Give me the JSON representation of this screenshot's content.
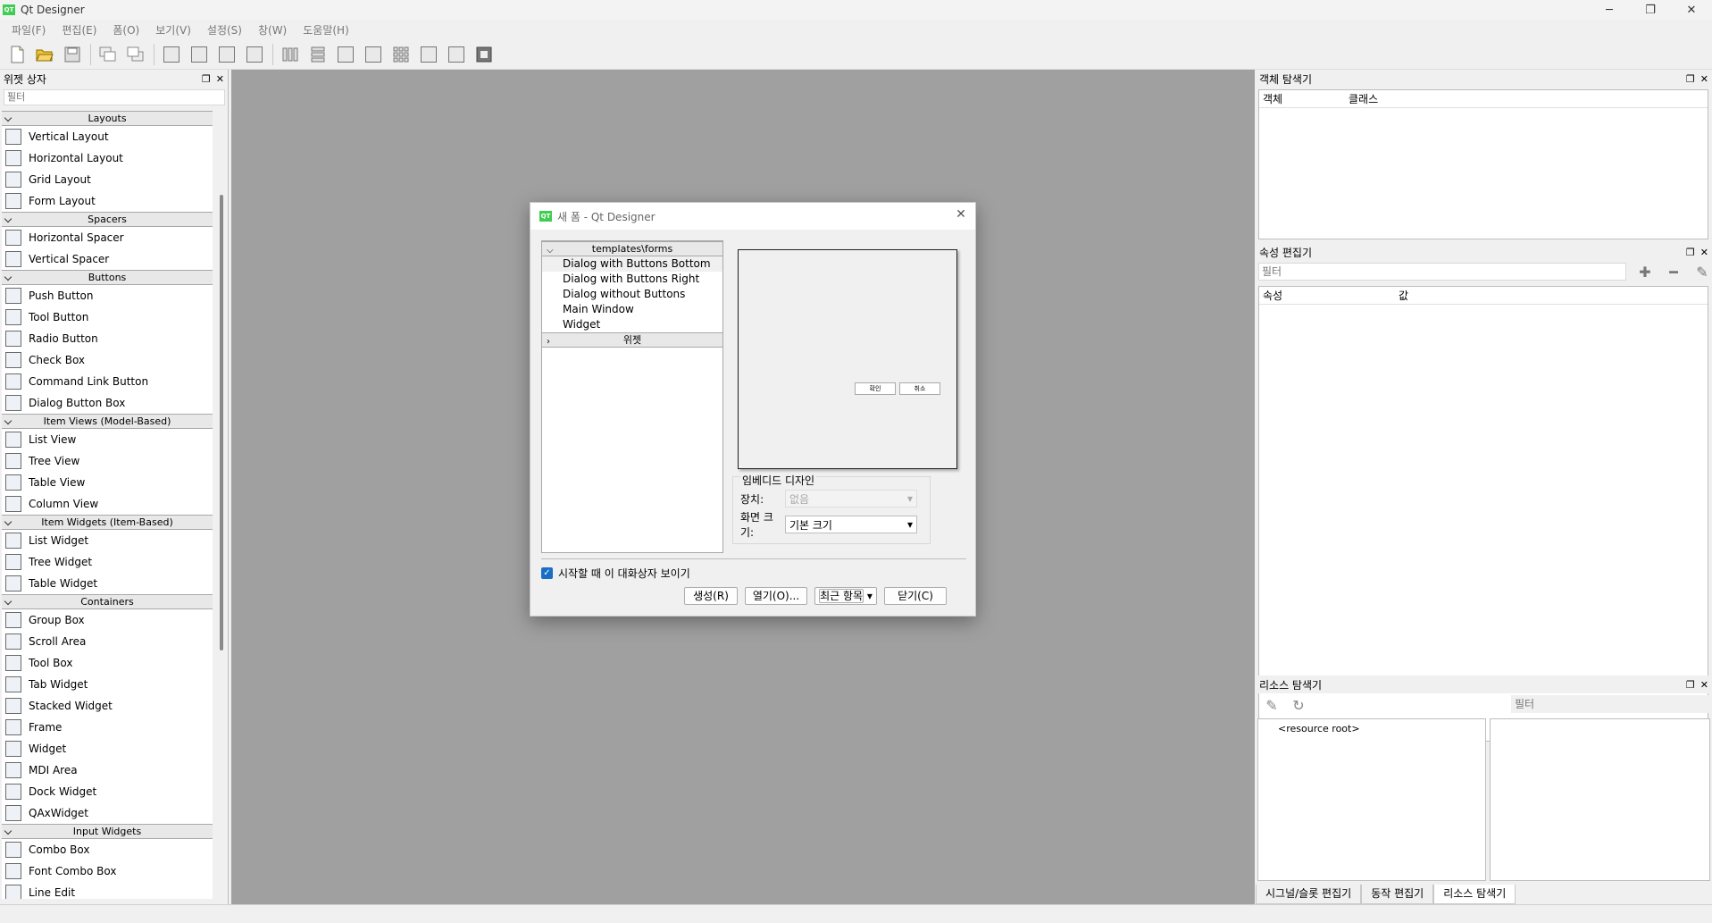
{
  "app": {
    "title": "Qt Designer",
    "icon_text": "QT"
  },
  "window_controls": {
    "minimize": "─",
    "restore": "❐",
    "close": "✕"
  },
  "menu": [
    "파일(F)",
    "편집(E)",
    "폼(O)",
    "보기(V)",
    "설정(S)",
    "창(W)",
    "도움말(H)"
  ],
  "widget_box": {
    "title": "위젯 상자",
    "filter_placeholder": "필터",
    "categories": [
      {
        "name": "Layouts",
        "items": [
          "Vertical Layout",
          "Horizontal Layout",
          "Grid Layout",
          "Form Layout"
        ]
      },
      {
        "name": "Spacers",
        "items": [
          "Horizontal Spacer",
          "Vertical Spacer"
        ]
      },
      {
        "name": "Buttons",
        "items": [
          "Push Button",
          "Tool Button",
          "Radio Button",
          "Check Box",
          "Command Link Button",
          "Dialog Button Box"
        ]
      },
      {
        "name": "Item Views (Model-Based)",
        "items": [
          "List View",
          "Tree View",
          "Table View",
          "Column View"
        ]
      },
      {
        "name": "Item Widgets (Item-Based)",
        "items": [
          "List Widget",
          "Tree Widget",
          "Table Widget"
        ]
      },
      {
        "name": "Containers",
        "items": [
          "Group Box",
          "Scroll Area",
          "Tool Box",
          "Tab Widget",
          "Stacked Widget",
          "Frame",
          "Widget",
          "MDI Area",
          "Dock Widget",
          "QAxWidget"
        ]
      },
      {
        "name": "Input Widgets",
        "items": [
          "Combo Box",
          "Font Combo Box",
          "Line Edit"
        ]
      }
    ]
  },
  "object_inspector": {
    "title": "객체 탐색기",
    "col_object": "객체",
    "col_class": "클래스"
  },
  "property_editor": {
    "title": "속성 편집기",
    "filter_placeholder": "필터",
    "col_property": "속성",
    "col_value": "값"
  },
  "resource_browser": {
    "title": "리소스 탐색기",
    "filter_placeholder": "필터",
    "root": "<resource root>"
  },
  "bottom_tabs": [
    "시그널/슬롯 편집기",
    "동작 편집기",
    "리소스 탐색기"
  ],
  "dialog": {
    "title": "새 폼 - Qt Designer",
    "template_category": "templates\\forms",
    "templates": [
      "Dialog with Buttons Bottom",
      "Dialog with Buttons Right",
      "Dialog without Buttons",
      "Main Window",
      "Widget"
    ],
    "selected_template": "Dialog with Buttons Bottom",
    "widgets_category": "위젯",
    "preview_ok": "확인",
    "preview_cancel": "취소",
    "embedded_title": "임베디드 디자인",
    "device_label": "장치:",
    "device_value": "없음",
    "screen_size_label": "화면 크기:",
    "screen_size_value": "기본 크기",
    "show_on_startup": "시작할 때 이 대화상자 보이기",
    "show_on_startup_checked": true,
    "buttons": {
      "create": "생성(R)",
      "open": "열기(O)...",
      "recent": "최근 항목",
      "close": "닫기(C)"
    }
  }
}
